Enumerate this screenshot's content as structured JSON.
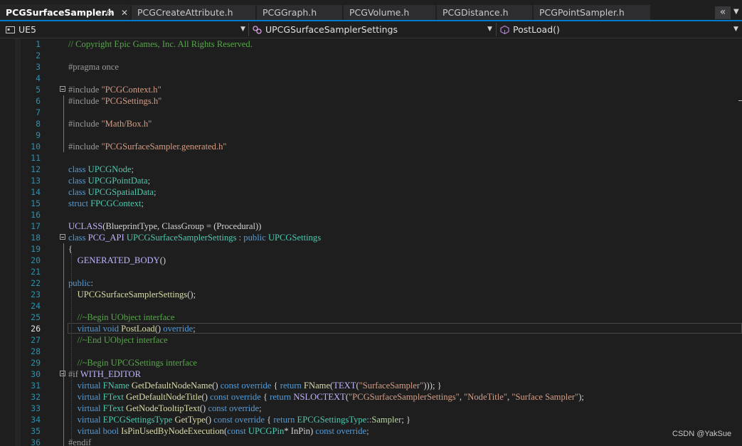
{
  "tabs": [
    {
      "label": "PCGSurfaceSampler.h",
      "active": true
    },
    {
      "label": "PCGCreateAttribute.h",
      "active": false
    },
    {
      "label": "PCGGraph.h",
      "active": false
    },
    {
      "label": "PCGVolume.h",
      "active": false
    },
    {
      "label": "PCGDistance.h",
      "active": false
    },
    {
      "label": "PCGPointSampler.h",
      "active": false
    }
  ],
  "tab_pin_glyph": "⊕",
  "tab_close_glyph": "✕",
  "tab_overflow_glyph": "«",
  "navbar": {
    "project": "UE5",
    "scope": "UPCGSurfaceSamplerSettings",
    "member": "PostLoad()"
  },
  "current_line": 26,
  "colors": {
    "keyword": "#569cd6",
    "type": "#4ec9b0",
    "string": "#d69d85",
    "comment": "#57a64a",
    "macro": "#beb7ff",
    "function": "#dcdcaa",
    "line_number": "#2b91af",
    "accent": "#007acc"
  },
  "lines": [
    [
      [
        "cm",
        "// Copyright Epic Games, Inc. All Rights Reserved."
      ]
    ],
    [],
    [
      [
        "pp",
        "#pragma once"
      ]
    ],
    [],
    [
      [
        "pp",
        "#include "
      ],
      [
        "str",
        "\"PCGContext.h\""
      ]
    ],
    [
      [
        "pp",
        "#include "
      ],
      [
        "str",
        "\"PCGSettings.h\""
      ]
    ],
    [],
    [
      [
        "pp",
        "#include "
      ],
      [
        "str",
        "\"Math/Box.h\""
      ]
    ],
    [],
    [
      [
        "pp",
        "#include "
      ],
      [
        "str",
        "\"PCGSurfaceSampler.generated.h\""
      ]
    ],
    [],
    [
      [
        "kw",
        "class "
      ],
      [
        "ty",
        "UPCGNode"
      ],
      [
        "punc",
        ";"
      ]
    ],
    [
      [
        "kw",
        "class "
      ],
      [
        "ty",
        "UPCGPointData"
      ],
      [
        "punc",
        ";"
      ]
    ],
    [
      [
        "kw",
        "class "
      ],
      [
        "ty",
        "UPCGSpatialData"
      ],
      [
        "punc",
        ";"
      ]
    ],
    [
      [
        "kw",
        "struct "
      ],
      [
        "ty",
        "FPCGContext"
      ],
      [
        "punc",
        ";"
      ]
    ],
    [],
    [
      [
        "mac",
        "UCLASS"
      ],
      [
        "",
        "(BlueprintType, ClassGroup = (Procedural))"
      ]
    ],
    [
      [
        "kw",
        "class "
      ],
      [
        "mac",
        "PCG_API "
      ],
      [
        "ty",
        "UPCGSurfaceSamplerSettings"
      ],
      [
        "punc",
        " : "
      ],
      [
        "kw",
        "public "
      ],
      [
        "ty",
        "UPCGSettings"
      ]
    ],
    [
      [
        "",
        "{"
      ]
    ],
    [
      [
        "",
        "    "
      ],
      [
        "mac",
        "GENERATED_BODY"
      ],
      [
        "",
        "()"
      ]
    ],
    [],
    [
      [
        "kw",
        "public"
      ],
      [
        "punc",
        ":"
      ]
    ],
    [
      [
        "",
        "    "
      ],
      [
        "fn",
        "UPCGSurfaceSamplerSettings"
      ],
      [
        "",
        "();"
      ]
    ],
    [],
    [
      [
        "",
        "    "
      ],
      [
        "cm",
        "//~Begin UObject interface"
      ]
    ],
    [
      [
        "",
        "    "
      ],
      [
        "kw",
        "virtual void "
      ],
      [
        "fn",
        "PostLoad"
      ],
      [
        "",
        "() "
      ],
      [
        "kw",
        "override"
      ],
      [
        "punc",
        ";"
      ]
    ],
    [
      [
        "",
        "    "
      ],
      [
        "cm",
        "//~End UObject interface"
      ]
    ],
    [],
    [
      [
        "",
        "    "
      ],
      [
        "cm",
        "//~Begin UPCGSettings interface"
      ]
    ],
    [
      [
        "pp",
        "#if "
      ],
      [
        "mac",
        "WITH_EDITOR"
      ]
    ],
    [
      [
        "",
        "    "
      ],
      [
        "kw",
        "virtual "
      ],
      [
        "ty",
        "FName "
      ],
      [
        "fn",
        "GetDefaultNodeName"
      ],
      [
        "",
        "() "
      ],
      [
        "kw",
        "const override "
      ],
      [
        "",
        "{ "
      ],
      [
        "kw",
        "return "
      ],
      [
        "fn",
        "FName"
      ],
      [
        "",
        "("
      ],
      [
        "mac",
        "TEXT"
      ],
      [
        "",
        "("
      ],
      [
        "str",
        "\"SurfaceSampler\""
      ],
      [
        "",
        "))); }"
      ]
    ],
    [
      [
        "",
        "    "
      ],
      [
        "kw",
        "virtual "
      ],
      [
        "ty",
        "FText "
      ],
      [
        "fn",
        "GetDefaultNodeTitle"
      ],
      [
        "",
        "() "
      ],
      [
        "kw",
        "const override "
      ],
      [
        "",
        "{ "
      ],
      [
        "kw",
        "return "
      ],
      [
        "mac",
        "NSLOCTEXT"
      ],
      [
        "",
        "("
      ],
      [
        "str",
        "\"PCGSurfaceSamplerSettings\""
      ],
      [
        "",
        ", "
      ],
      [
        "str",
        "\"NodeTitle\""
      ],
      [
        "",
        ", "
      ],
      [
        "str",
        "\"Surface Sampler\""
      ],
      [
        "",
        ");"
      ]
    ],
    [
      [
        "",
        "    "
      ],
      [
        "kw",
        "virtual "
      ],
      [
        "ty",
        "FText "
      ],
      [
        "fn",
        "GetNodeTooltipText"
      ],
      [
        "",
        "() "
      ],
      [
        "kw",
        "const override"
      ],
      [
        "punc",
        ";"
      ]
    ],
    [
      [
        "",
        "    "
      ],
      [
        "kw",
        "virtual "
      ],
      [
        "ty",
        "EPCGSettingsType "
      ],
      [
        "fn",
        "GetType"
      ],
      [
        "",
        "() "
      ],
      [
        "kw",
        "const override "
      ],
      [
        "",
        "{ "
      ],
      [
        "kw",
        "return "
      ],
      [
        "ty",
        "EPCGSettingsType"
      ],
      [
        "punc",
        "::"
      ],
      [
        "enm",
        "Sampler"
      ],
      [
        "",
        "; }"
      ]
    ],
    [
      [
        "",
        "    "
      ],
      [
        "kw",
        "virtual bool "
      ],
      [
        "fn",
        "IsPinUsedByNodeExecution"
      ],
      [
        "",
        "("
      ],
      [
        "kw",
        "const "
      ],
      [
        "ty",
        "UPCGPin"
      ],
      [
        "",
        "* InPin) "
      ],
      [
        "kw",
        "const override"
      ],
      [
        "punc",
        ";"
      ]
    ],
    [
      [
        "pp",
        "#endif"
      ]
    ]
  ],
  "fold_lines": [
    5,
    18,
    30
  ],
  "watermark": "CSDN @YakSue"
}
